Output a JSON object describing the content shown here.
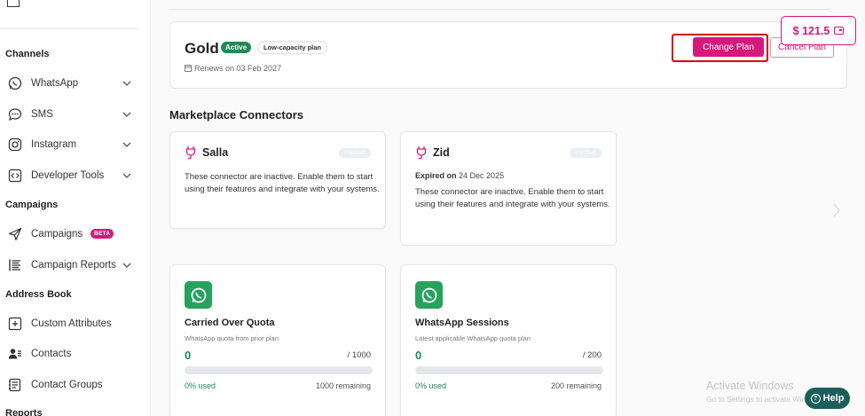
{
  "sidebar": {
    "sections": {
      "channels": "Channels",
      "campaigns": "Campaigns",
      "address_book": "Address Book",
      "reports": "Reports"
    },
    "items": [
      {
        "label": "WhatsApp",
        "icon": "whatsapp-icon"
      },
      {
        "label": "SMS",
        "icon": "sms-icon"
      },
      {
        "label": "Instagram",
        "icon": "instagram-icon"
      },
      {
        "label": "Developer Tools",
        "icon": "code-icon"
      },
      {
        "label": "Campaigns",
        "icon": "send-icon",
        "badge": "BETA"
      },
      {
        "label": "Campaign Reports",
        "icon": "report-icon"
      },
      {
        "label": "Custom Attributes",
        "icon": "attribute-icon"
      },
      {
        "label": "Contacts",
        "icon": "contacts-icon"
      },
      {
        "label": "Contact Groups",
        "icon": "contact-groups-icon"
      }
    ]
  },
  "balance": {
    "amount": "$ 121.5"
  },
  "plan": {
    "name": "Gold",
    "status": "Active",
    "capacity": "Low-capacity plan",
    "renews": "Renews on 03 Feb 2027",
    "change_label": "Change Plan",
    "cancel_label": "Cancel Plan"
  },
  "marketplace": {
    "title": "Marketplace Connectors",
    "connectors": [
      {
        "name": "Salla",
        "status": "Inactive",
        "description": "These connector are inactive. Enable them to start using their features and integrate with your systems."
      },
      {
        "name": "Zid",
        "status": "Inactive",
        "expired_label": "Expired on",
        "expired_date": "24 Dec 2025",
        "description": "These connector are inactive. Enable them to start using their features and integrate with your systems."
      }
    ]
  },
  "quotas": [
    {
      "title": "Carried Over Quota",
      "subtitle": "WhatsApp quota from prior plan",
      "value": "0",
      "total": "/ 1000",
      "used": "0% used",
      "remaining": "1000 remaining",
      "used_fraction": 0
    },
    {
      "title": "WhatsApp Sessions",
      "subtitle": "Latest applicable WhatsApp quota plan",
      "value": "0",
      "total": "/ 200",
      "used": "0% used",
      "remaining": "200 remaining",
      "used_fraction": 0
    }
  ],
  "watermark": {
    "line1": "Activate Windows",
    "line2": "Go to Settings to activate Windows."
  },
  "help": {
    "label": "Help"
  },
  "colors": {
    "brand": "#d6187a",
    "success": "#1e8a55",
    "whatsapp": "#25a35c",
    "help": "#1b5e5a"
  }
}
